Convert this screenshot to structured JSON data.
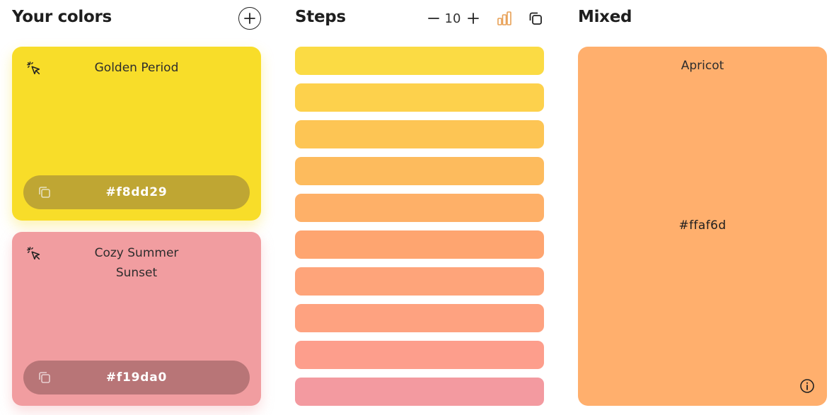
{
  "columns": {
    "your_colors": {
      "title": "Your colors"
    },
    "steps": {
      "title": "Steps",
      "count": "10"
    },
    "mixed": {
      "title": "Mixed"
    }
  },
  "colors": [
    {
      "name": "Golden Period",
      "hex": "#f8dd29",
      "bg": "#f8dd29",
      "bar": "#bfa633"
    },
    {
      "name": "Cozy Summer Sunset",
      "name_line1": "Cozy Summer",
      "name_line2": "Sunset",
      "hex": "#f19da0",
      "bg": "#f19da0",
      "bar": "#b87577"
    }
  ],
  "steps_colors": [
    "#fbdb44",
    "#fdd14c",
    "#fdc554",
    "#fdbb5d",
    "#feb068",
    "#fea570",
    "#fea47a",
    "#fea280",
    "#fd9e8c",
    "#f39aa0"
  ],
  "mixed_result": {
    "name": "Apricot",
    "hex": "#ffaf6d",
    "bg": "#ffaf6d"
  },
  "icons": {
    "add": "plus-circle-icon",
    "pick": "cursor-click-icon",
    "copy": "copy-icon",
    "minus": "minus-icon",
    "plus": "plus-icon",
    "chart": "bar-chart-icon",
    "info": "info-icon"
  },
  "accent": "#e8a055"
}
